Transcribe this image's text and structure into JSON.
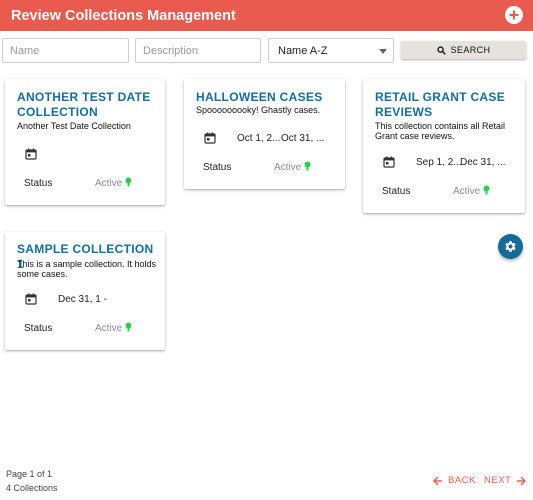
{
  "appbar": {
    "title": "Review Collections Management",
    "add_icon": "plus-circle-icon"
  },
  "filters": {
    "name_placeholder": "Name",
    "description_placeholder": "Description",
    "sort_value": "Name A-Z",
    "search_label": "SEARCH"
  },
  "cards": [
    {
      "title": "ANOTHER TEST DATE COLLECTION",
      "description": "Another Test Date Collection",
      "date_start": "",
      "date_end": "",
      "status_label": "Status",
      "status_value": "Active"
    },
    {
      "title": "HALLOWEEN CASES",
      "description": "Spooooooooky! Ghastly cases.",
      "date_start": "Oct 1, 2...",
      "date_end": "Oct 31, ...",
      "status_label": "Status",
      "status_value": "Active"
    },
    {
      "title": "RETAIL GRANT CASE REVIEWS",
      "description": "This collection contains all Retail Grant case reviews.",
      "date_start": "Sep 1, 2...",
      "date_end": "Dec 31, ...",
      "status_label": "Status",
      "status_value": "Active"
    },
    {
      "title": "SAMPLE COLLECTION 1",
      "description": "This is a sample collection. It holds some cases.",
      "date_start": "Dec 31, 1 -",
      "date_end": "",
      "status_label": "Status",
      "status_value": "Active"
    }
  ],
  "footer": {
    "page": "Page 1 of 1",
    "count": "4 Collections",
    "back_label": "BACK",
    "next_label": "NEXT"
  },
  "colors": {
    "appbar": "#e95a4f",
    "card_title": "#176c9a",
    "fab": "#166a98",
    "status_dot": "#2ecc4f",
    "nav": "#e95a4f"
  }
}
